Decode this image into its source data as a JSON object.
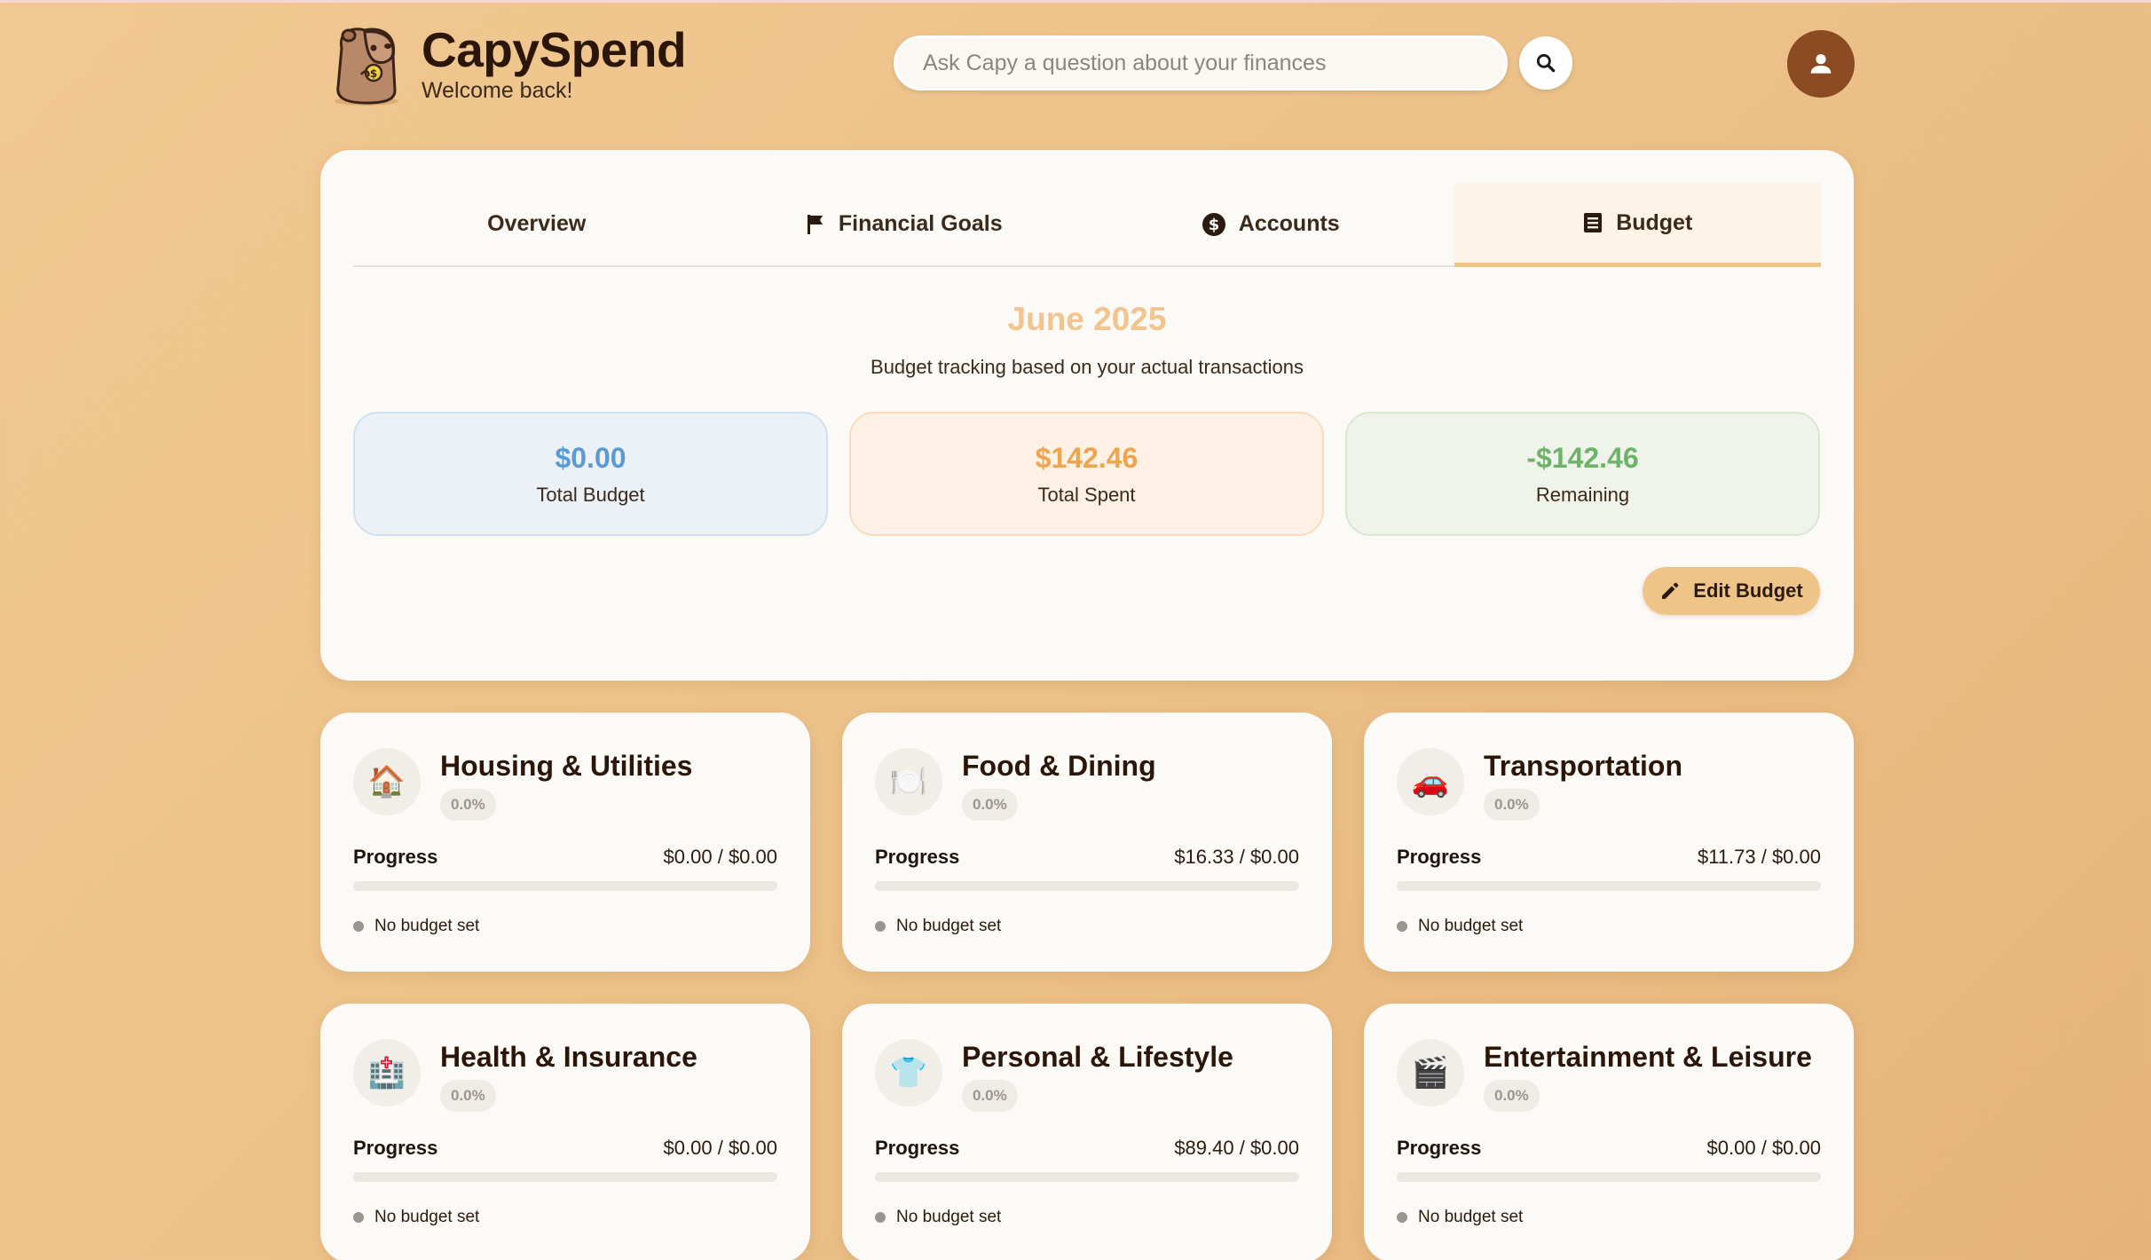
{
  "app": {
    "title": "CapySpend",
    "subtitle": "Welcome back!"
  },
  "search": {
    "placeholder": "Ask Capy a question about your finances",
    "value": ""
  },
  "tabs": [
    {
      "label": "Overview",
      "icon": null
    },
    {
      "label": "Financial Goals",
      "icon": "flag-icon"
    },
    {
      "label": "Accounts",
      "icon": "dollar-circle-icon"
    },
    {
      "label": "Budget",
      "icon": "receipt-icon",
      "active": true
    }
  ],
  "budget": {
    "month": "June 2025",
    "description": "Budget tracking based on your actual transactions",
    "total_budget": {
      "value": "$0.00",
      "label": "Total Budget"
    },
    "total_spent": {
      "value": "$142.46",
      "label": "Total Spent"
    },
    "remaining": {
      "value": "-$142.46",
      "label": "Remaining"
    },
    "edit_label": "Edit Budget"
  },
  "categories": [
    {
      "name": "Housing & Utilities",
      "icon": "🏠",
      "icon_name": "house-icon",
      "percent": "0.0%",
      "progress_label": "Progress",
      "amount": "$0.00 / $0.00",
      "progress": 0,
      "status": "No budget set"
    },
    {
      "name": "Food & Dining",
      "icon": "🍽️",
      "icon_name": "plate-cutlery-icon",
      "percent": "0.0%",
      "progress_label": "Progress",
      "amount": "$16.33 / $0.00",
      "progress": 0,
      "status": "No budget set"
    },
    {
      "name": "Transportation",
      "icon": "🚗",
      "icon_name": "car-icon",
      "percent": "0.0%",
      "progress_label": "Progress",
      "amount": "$11.73 / $0.00",
      "progress": 0,
      "status": "No budget set"
    },
    {
      "name": "Health & Insurance",
      "icon": "🏥",
      "icon_name": "hospital-icon",
      "percent": "0.0%",
      "progress_label": "Progress",
      "amount": "$0.00 / $0.00",
      "progress": 0,
      "status": "No budget set"
    },
    {
      "name": "Personal & Lifestyle",
      "icon": "👕",
      "icon_name": "shirt-icon",
      "percent": "0.0%",
      "progress_label": "Progress",
      "amount": "$89.40 / $0.00",
      "progress": 0,
      "status": "No budget set"
    },
    {
      "name": "Entertainment & Leisure",
      "icon": "🎬",
      "icon_name": "clapperboard-icon",
      "percent": "0.0%",
      "progress_label": "Progress",
      "amount": "$0.00 / $0.00",
      "progress": 0,
      "status": "No budget set"
    }
  ],
  "colors": {
    "accent": "#eec488",
    "budget_blue": "#5b9bd5",
    "spent_orange": "#eda54e",
    "remaining_green": "#6eb26b",
    "avatar_brown": "#8a4a22"
  }
}
